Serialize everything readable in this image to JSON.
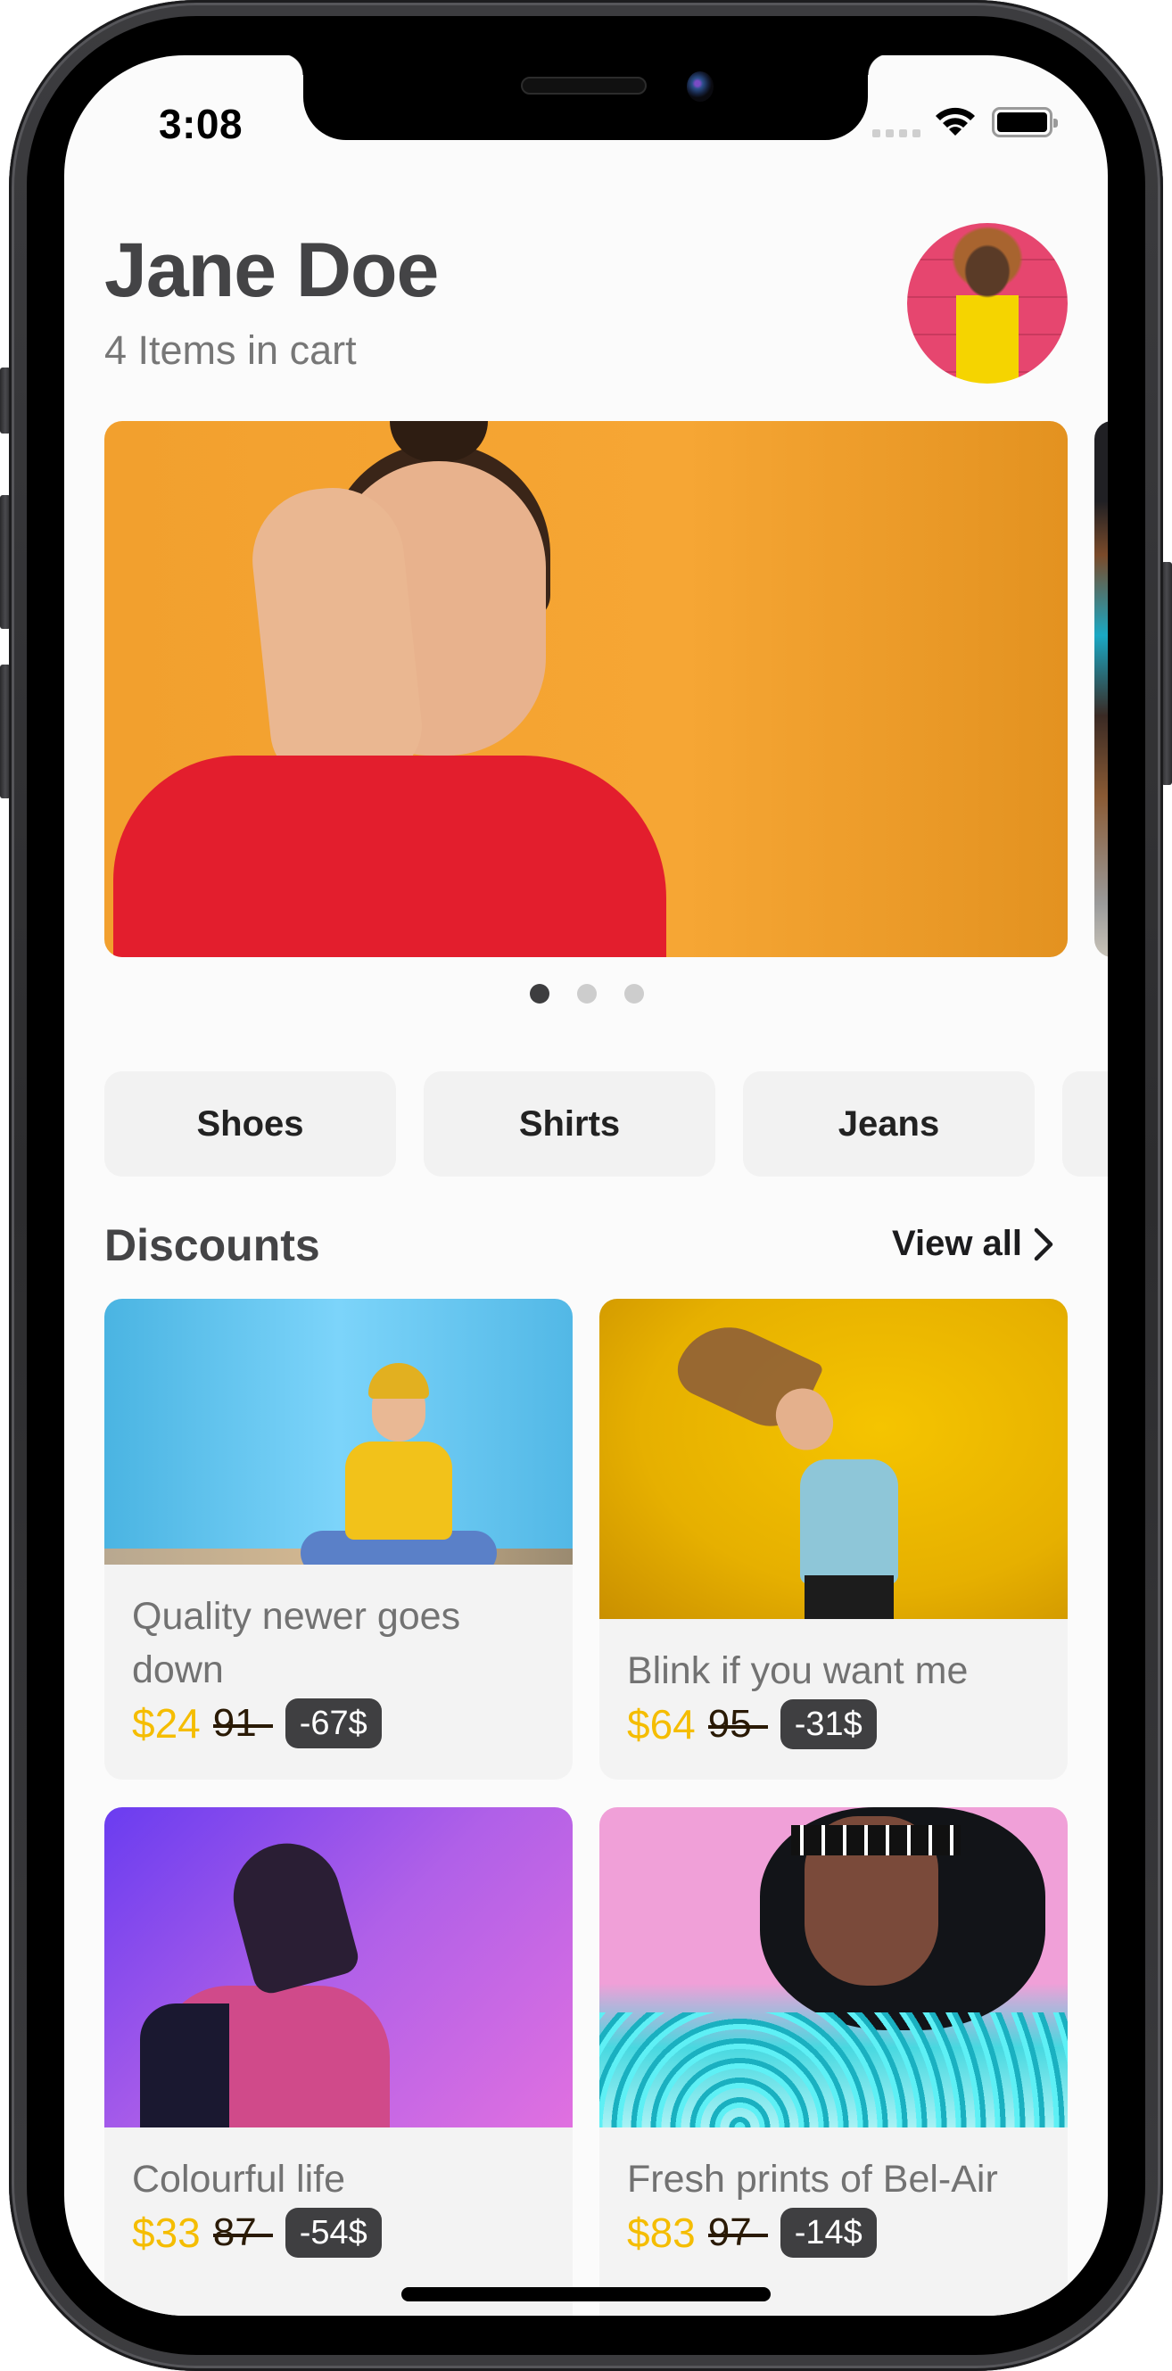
{
  "status_bar": {
    "time": "3:08",
    "signal_icon": "cellular-signal-icon",
    "wifi_icon": "wifi-icon",
    "battery_icon": "battery-full-icon"
  },
  "header": {
    "user_name": "Jane Doe",
    "cart_summary": "4 Items in cart",
    "avatar_icon": "user-avatar"
  },
  "banner": {
    "slide_count": 3,
    "active_index": 0,
    "accent": "#f4a02e"
  },
  "categories": [
    {
      "label": "Shoes"
    },
    {
      "label": "Shirts"
    },
    {
      "label": "Jeans"
    },
    {
      "label": ""
    }
  ],
  "discounts": {
    "title": "Discounts",
    "view_all_label": "View all",
    "view_all_icon": "chevron-right-icon",
    "items": [
      {
        "title": "Quality newer goes down",
        "price": "$24",
        "old_price": "91",
        "discount": "-67$"
      },
      {
        "title": "Blink if you want me",
        "price": "$64",
        "old_price": "95",
        "discount": "-31$"
      },
      {
        "title": "Colourful life",
        "price": "$33",
        "old_price": "87",
        "discount": "-54$"
      },
      {
        "title": "Fresh prints of Bel-Air",
        "price": "$83",
        "old_price": "97",
        "discount": "-14$"
      }
    ]
  },
  "colors": {
    "price": "#f5bd00",
    "discount_badge": "#3f3f41",
    "title_text": "#444446",
    "chip_bg": "#f2f2f2"
  }
}
